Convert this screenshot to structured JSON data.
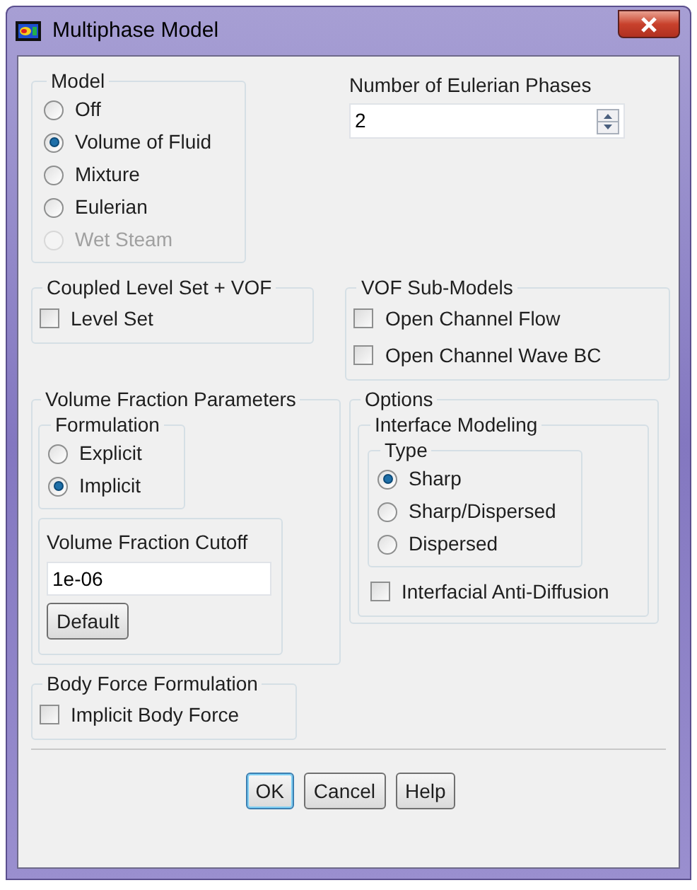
{
  "window": {
    "title": "Multiphase Model"
  },
  "model": {
    "label": "Model",
    "options": [
      {
        "label": "Off",
        "selected": false,
        "disabled": false
      },
      {
        "label": "Volume of Fluid",
        "selected": true,
        "disabled": false
      },
      {
        "label": "Mixture",
        "selected": false,
        "disabled": false
      },
      {
        "label": "Eulerian",
        "selected": false,
        "disabled": false
      },
      {
        "label": "Wet Steam",
        "selected": false,
        "disabled": true
      }
    ]
  },
  "eulerian_phases": {
    "label": "Number of Eulerian Phases",
    "value": "2"
  },
  "coupled_level_set": {
    "label": "Coupled Level Set + VOF",
    "checkboxes": [
      {
        "label": "Level Set",
        "checked": false
      }
    ]
  },
  "vof_sub_models": {
    "label": "VOF Sub-Models",
    "checkboxes": [
      {
        "label": "Open Channel Flow",
        "checked": false
      },
      {
        "label": "Open Channel Wave BC",
        "checked": false
      }
    ]
  },
  "volume_fraction_parameters": {
    "label": "Volume Fraction Parameters",
    "formulation": {
      "label": "Formulation",
      "options": [
        {
          "label": "Explicit",
          "selected": false,
          "disabled": false
        },
        {
          "label": "Implicit",
          "selected": true,
          "disabled": false
        }
      ]
    },
    "cutoff": {
      "label": "Volume Fraction Cutoff",
      "value": "1e-06",
      "button": "Default"
    }
  },
  "options": {
    "label": "Options",
    "interface_modeling": {
      "label": "Interface Modeling",
      "type": {
        "label": "Type",
        "options": [
          {
            "label": "Sharp",
            "selected": true,
            "disabled": false
          },
          {
            "label": "Sharp/Dispersed",
            "selected": false,
            "disabled": false
          },
          {
            "label": "Dispersed",
            "selected": false,
            "disabled": false
          }
        ]
      },
      "checkboxes": [
        {
          "label": "Interfacial Anti-Diffusion",
          "checked": false
        }
      ]
    }
  },
  "body_force": {
    "label": "Body Force Formulation",
    "checkboxes": [
      {
        "label": "Implicit Body Force",
        "checked": false
      }
    ]
  },
  "buttons": [
    {
      "label": "OK",
      "default": true
    },
    {
      "label": "Cancel",
      "default": false
    },
    {
      "label": "Help",
      "default": false
    }
  ]
}
